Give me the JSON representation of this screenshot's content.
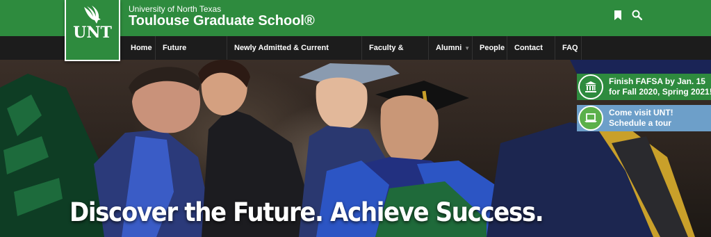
{
  "header": {
    "logo_text": "UNT",
    "university": "University of North Texas",
    "school": "Toulouse Graduate School®"
  },
  "nav": {
    "items": [
      {
        "label": "Home",
        "dropdown": false
      },
      {
        "label": "Future Students",
        "dropdown": true
      },
      {
        "label": "Newly Admitted & Current Students",
        "dropdown": true
      },
      {
        "label": "Faculty & Staff",
        "dropdown": true
      },
      {
        "label": "Alumni",
        "dropdown": true
      },
      {
        "label": "People",
        "dropdown": false
      },
      {
        "label": "Contact Us",
        "dropdown": false
      },
      {
        "label": "FAQ",
        "dropdown": false
      }
    ]
  },
  "hero": {
    "headline": "Discover the Future. Achieve Success."
  },
  "promos": [
    {
      "line1": "Finish FAFSA by Jan. 15",
      "line2": "for Fall 2020, Spring 2021!",
      "icon": "bank-icon"
    },
    {
      "line1": "Come visit UNT!",
      "line2": "Schedule a tour",
      "icon": "laptop-icon"
    }
  ],
  "colors": {
    "brand_green": "#2e8b3e",
    "nav_bg": "#1c1c1c",
    "promo_blue": "#6d9fc9"
  }
}
